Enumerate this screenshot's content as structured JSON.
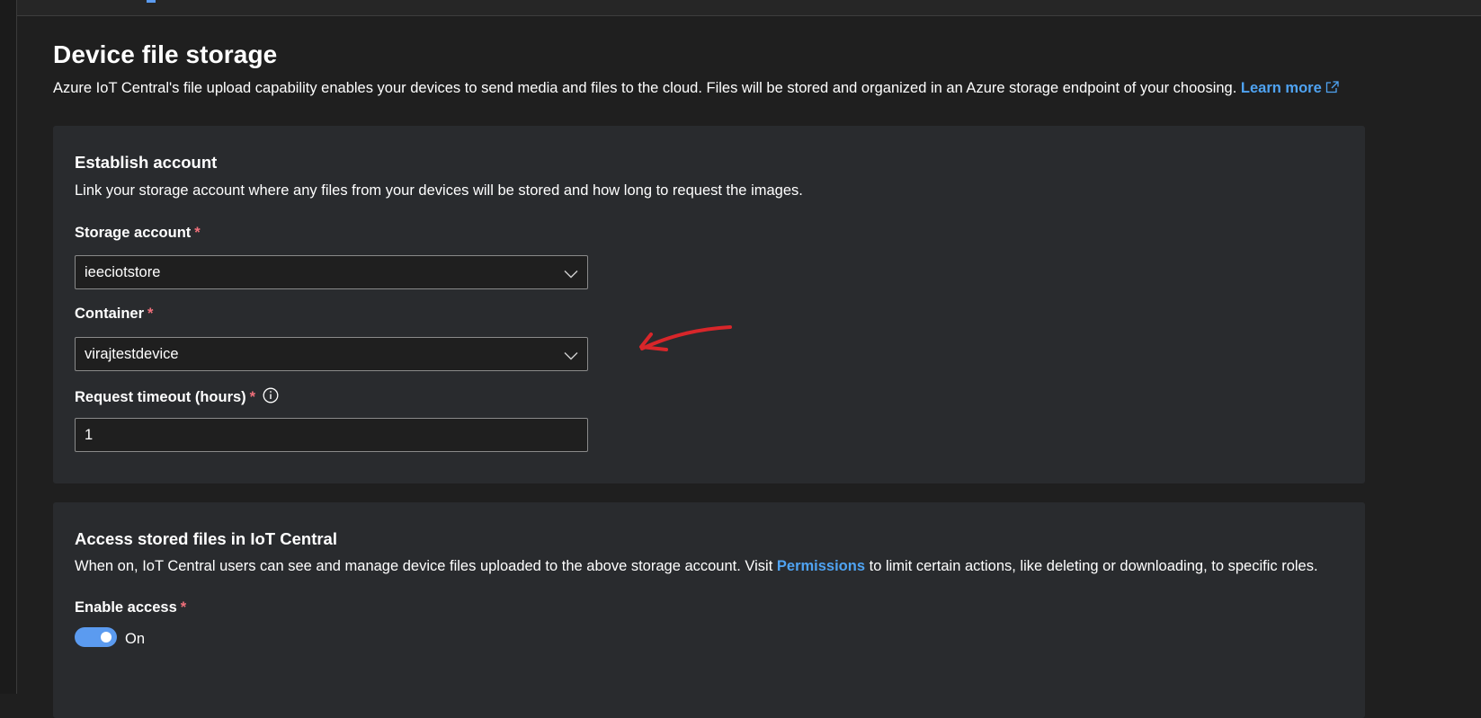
{
  "page": {
    "title": "Device file storage",
    "description": "Azure IoT Central's file upload capability enables your devices to send media and files to the cloud. Files will be stored and organized in an Azure storage endpoint of your choosing.",
    "learn_more_label": "Learn more",
    "learn_more_icon": "external-link-icon"
  },
  "establish_account": {
    "title": "Establish account",
    "description": "Link your storage account where any files from your devices will be stored and how long to request the images.",
    "storage_account": {
      "label": "Storage account",
      "required_mark": "*",
      "value": "ieeciotstore"
    },
    "container": {
      "label": "Container",
      "required_mark": "*",
      "value": "virajtestdevice"
    },
    "request_timeout": {
      "label": "Request timeout (hours)",
      "required_mark": "*",
      "value": "1",
      "info_icon": "info-icon"
    }
  },
  "access_files": {
    "title": "Access stored files in IoT Central",
    "description_prefix": "When on, IoT Central users can see and manage device files uploaded to the above storage account. Visit",
    "permissions_link": "Permissions",
    "description_suffix": "to limit certain actions, like deleting or downloading, to specific roles.",
    "enable_access": {
      "label": "Enable access",
      "required_mark": "*",
      "state": true,
      "state_label": "On"
    }
  },
  "colors": {
    "background": "#1f1f1f",
    "card": "#292b2e",
    "link": "#4fa3f2",
    "required": "#f1707b",
    "toggle_on": "#5b9bf0",
    "annotation": "#d8262a"
  }
}
